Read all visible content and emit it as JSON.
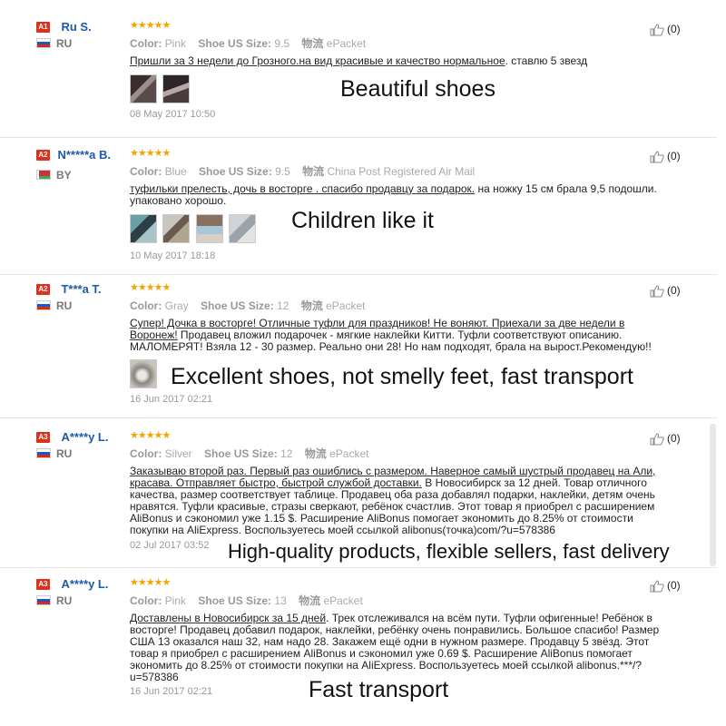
{
  "reviews": [
    {
      "level": "A1",
      "name": "Ru S.",
      "country": "RU",
      "flag": "ru",
      "stars": "★★★★★",
      "color_label": "Color:",
      "color": "Pink",
      "size_label": "Shoe US Size:",
      "size": "9.5",
      "ship_label": "物流",
      "ship": "ePacket",
      "text_segments": [
        {
          "t": "Пришли за 3 недели до Грозного.на вид красивые и качество нормальное",
          "u": true
        },
        {
          "t": ". ставлю 5 звезд",
          "u": false
        }
      ],
      "thumb_count": 2,
      "date": "08 May 2017 10:50",
      "caption": "Beautiful shoes",
      "helpful": "(0)"
    },
    {
      "level": "A2",
      "name": "N*****a B.",
      "country": "BY",
      "flag": "by",
      "stars": "★★★★★",
      "color_label": "Color:",
      "color": "Blue",
      "size_label": "Shoe US Size:",
      "size": "9.5",
      "ship_label": "物流",
      "ship": "China Post Registered Air Mail",
      "text_segments": [
        {
          "t": "туфильки прелесть, дочь в восторге . спасибо продавцу за подарок.",
          "u": true
        },
        {
          "t": " на ножку 15 см брала 9,5 подошли. упаковано хорошо.",
          "u": false
        }
      ],
      "thumb_count": 4,
      "date": "10 May 2017 18:18",
      "caption": "Children like it",
      "helpful": "(0)"
    },
    {
      "level": "A2",
      "name": "T***a T.",
      "country": "RU",
      "flag": "ru",
      "stars": "★★★★★",
      "color_label": "Color:",
      "color": "Gray",
      "size_label": "Shoe US Size:",
      "size": "12",
      "ship_label": "物流",
      "ship": "ePacket",
      "text_segments": [
        {
          "t": "Супер! Дочка в восторге! Отличные туфли для праздников! Не воняют. Приехали за две недели в Воронеж!",
          "u": true
        },
        {
          "t": " Продавец вложил подарочек - мягкие наклейки Китти. Туфли соответствуют описанию. МАЛОМЕРЯТ! Взяла 12 - 30 размер. Реально они 28! Но нам подходят, брала на вырост.Рекомендую!!",
          "u": false
        }
      ],
      "thumb_count": 1,
      "date": "16 Jun 2017 02:21",
      "caption": "Excellent shoes, not smelly feet, fast transport",
      "helpful": "(0)"
    },
    {
      "level": "A3",
      "name": "A****y L.",
      "country": "RU",
      "flag": "ru",
      "stars": "★★★★★",
      "color_label": "Color:",
      "color": "Silver",
      "size_label": "Shoe US Size:",
      "size": "12",
      "ship_label": "物流",
      "ship": "ePacket",
      "text_segments": [
        {
          "t": "Заказываю второй раз. Первый раз ошиблись с размером. Наверное самый шустрый продавец на Али, красава. Отправляет быстро, быстрой службой доставки.",
          "u": true
        },
        {
          "t": " В Новосибирск за 12 дней. Товар отличного качества, размер соответствует таблице. Продавец оба раза добавлял подарки, наклейки, детям очень нравятся. Туфли красивые, стразы сверкают, ребёнок счастлив. Этот товар я приобрел с расширением AliBonus и сэкономил уже 1.15 $. Расширение AliBonus помогает экономить до 8.25% от стоимости покупки на AliExpress. Воспользуетесь моей ссылкой alibonus(точка)com/?u=578386",
          "u": false
        }
      ],
      "thumb_count": 0,
      "date": "02 Jul 2017 03:52",
      "caption": "High-quality products, flexible sellers, fast delivery",
      "helpful": "(0)"
    },
    {
      "level": "A3",
      "name": "A****y L.",
      "country": "RU",
      "flag": "ru",
      "stars": "★★★★★",
      "color_label": "Color:",
      "color": "Pink",
      "size_label": "Shoe US Size:",
      "size": "13",
      "ship_label": "物流",
      "ship": "ePacket",
      "text_segments": [
        {
          "t": "Доставлены в Новосибирск за 15 дней",
          "u": true
        },
        {
          "t": ". Трек отслеживался на всём пути. Туфли офигенные! Ребёнок в восторге! Продавец добавил подарок, наклейки, ребёнку очень понравились. Большое спасибо! Размер США 13 оказался наш 32, нам надо 28. Закажем ещё одни в нужном размере. Продавцу 5 звёзд. Этот товар я приобрел с расширением AliBonus и сэкономил уже 0.69 $. Расширение AliBonus помогает экономить до 8.25% от стоимости покупки на AliExpress. Воспользуетесь моей ссылкой alibonus.***/?u=578386",
          "u": false
        }
      ],
      "thumb_count": 0,
      "date": "16 Jun 2017 02:21",
      "caption": "Fast transport",
      "helpful": "(0)"
    }
  ]
}
